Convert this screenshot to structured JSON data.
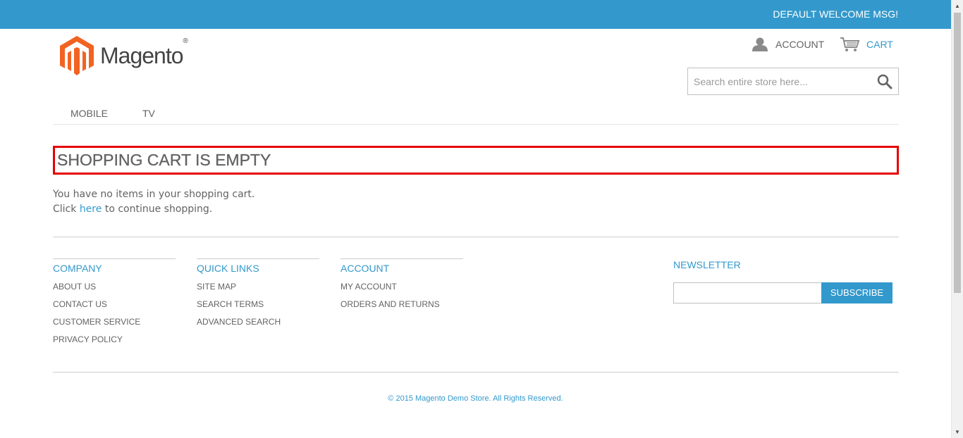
{
  "header": {
    "welcome": "DEFAULT WELCOME MSG!",
    "logo_text": "Magento",
    "logo_reg": "®",
    "account_label": "ACCOUNT",
    "cart_label": "CART",
    "search_placeholder": "Search entire store here..."
  },
  "nav": {
    "items": [
      {
        "label": "MOBILE"
      },
      {
        "label": "TV"
      }
    ]
  },
  "main": {
    "title": "SHOPPING CART IS EMPTY",
    "line1": "You have no items in your shopping cart.",
    "line2_pre": "Click ",
    "line2_link": "here",
    "line2_post": " to continue shopping."
  },
  "footer": {
    "columns": [
      {
        "title": "COMPANY",
        "links": [
          "ABOUT US",
          "CONTACT US",
          "CUSTOMER SERVICE",
          "PRIVACY POLICY"
        ]
      },
      {
        "title": "QUICK LINKS",
        "links": [
          "SITE MAP",
          "SEARCH TERMS",
          "ADVANCED SEARCH"
        ]
      },
      {
        "title": "ACCOUNT",
        "links": [
          "MY ACCOUNT",
          "ORDERS AND RETURNS"
        ]
      }
    ],
    "newsletter_title": "NEWSLETTER",
    "subscribe_label": "SUBSCRIBE",
    "copyright": "© 2015 Magento Demo Store. All Rights Reserved."
  },
  "colors": {
    "accent": "#3399cc",
    "logo_orange": "#f26322",
    "highlight_border": "#e60000"
  },
  "icons": {
    "account": "user-icon",
    "cart": "cart-icon",
    "search": "search-icon"
  }
}
